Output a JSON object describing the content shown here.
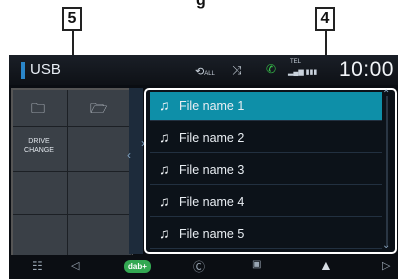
{
  "header": {
    "top_title": "g",
    "source_label": "USB",
    "clock": "10:00",
    "status": {
      "repeat_label": "ALL",
      "tel_label": "TEL"
    }
  },
  "callouts": {
    "left": "5",
    "right": "4"
  },
  "left_panel": {
    "drive_change_line1": "DRIVE",
    "drive_change_line2": "CHANGE"
  },
  "file_list": {
    "items": [
      {
        "label": "File name 1",
        "selected": true
      },
      {
        "label": "File name 2",
        "selected": false
      },
      {
        "label": "File name 3",
        "selected": false
      },
      {
        "label": "File name 4",
        "selected": false
      },
      {
        "label": "File name 5",
        "selected": false
      }
    ]
  },
  "bottom_bar": {
    "dab_label": "dab+"
  },
  "colors": {
    "accent": "#2a86c9",
    "selected_row": "#0e8fa8",
    "dab_green": "#33a852"
  }
}
